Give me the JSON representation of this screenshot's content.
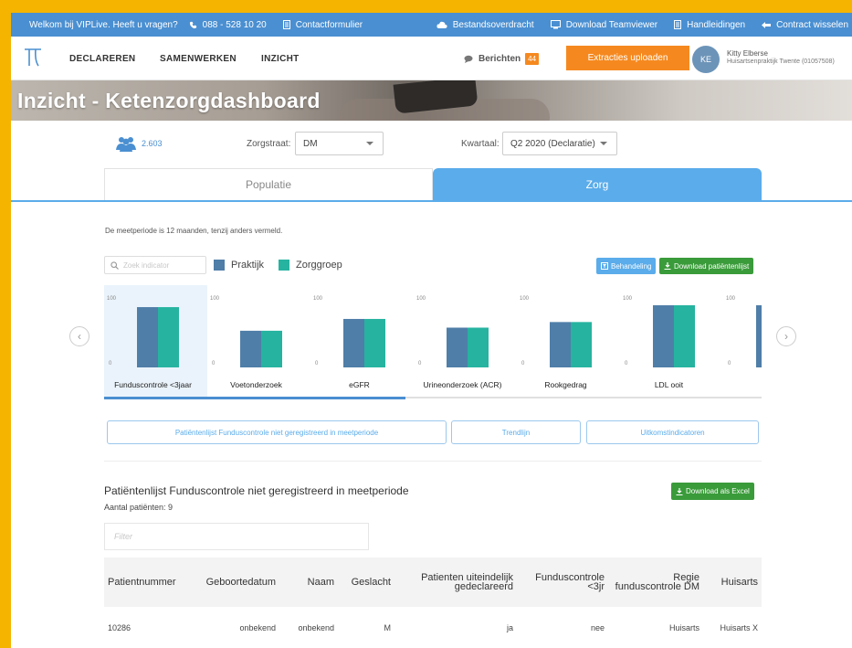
{
  "infobar": {
    "welcome": "Welkom bij VIPLive. Heeft u vragen?",
    "phone": "088 - 528 10 20",
    "contact": "Contactformulier",
    "transfer": "Bestandsoverdracht",
    "teamviewer": "Download Teamviewer",
    "manuals": "Handleidingen",
    "switch_contract": "Contract wisselen"
  },
  "nav": {
    "items": [
      "DECLAREREN",
      "SAMENWERKEN",
      "INZICHT"
    ],
    "berichten_label": "Berichten",
    "berichten_count": "44",
    "upload_button": "Extracties uploaden",
    "user_initials": "KE",
    "user_name": "Kitty Elberse",
    "user_org": "Huisartsenpraktijk Twente (01057508)"
  },
  "hero": {
    "title": "Inzicht - Ketenzorgdashboard"
  },
  "filters": {
    "patient_count": "2.603",
    "zorgstraat_label": "Zorgstraat:",
    "zorgstraat_value": "DM",
    "kwartaal_label": "Kwartaal:",
    "kwartaal_value": "Q2 2020 (Declaratie)"
  },
  "tabs": [
    "Populatie",
    "Zorg"
  ],
  "content": {
    "note": "De meetperiode is 12 maanden, tenzij anders vermeld.",
    "search_placeholder": "Zoek indicator",
    "behandeling_button": "Behandeling",
    "download_patientenlijst": "Download patiëntenlijst"
  },
  "colors": {
    "praktijk": "#4f7ea8",
    "zorggroep": "#26b3a0",
    "accent": "#5aacea",
    "green": "#3a9b3a",
    "orange": "#f5891f"
  },
  "chart_data": {
    "type": "bar",
    "categories": [
      "Funduscontrole <3jaar",
      "Voetonderzoek",
      "eGFR",
      "Urineonderzoek (ACR)",
      "Rookgedrag",
      "LDL ooit",
      ""
    ],
    "series": [
      {
        "name": "Praktijk",
        "values": [
          97,
          59,
          78,
          64,
          73,
          100,
          100
        ]
      },
      {
        "name": "Zorggroep",
        "values": [
          97,
          59,
          78,
          64,
          73,
          100,
          100
        ]
      }
    ],
    "ylim": [
      0,
      100
    ],
    "tick_max_label": "100",
    "tick_min_label": "0",
    "selected_index": 0
  },
  "subtabs": [
    "Patiëntenlijst Funduscontrole niet geregistreerd in meetperiode",
    "Trendlijn",
    "Uitkomstindicatoren"
  ],
  "list": {
    "title": "Patiëntenlijst Funduscontrole niet geregistreerd in meetperiode",
    "count_label": "Aantal patiënten: 9",
    "excel_button": "Download als Excel",
    "filter_placeholder": "Filter",
    "headers": [
      "Patientnummer",
      "Geboortedatum",
      "Naam",
      "Geslacht",
      "Patienten uiteindelijk gedeclareerd",
      "Funduscontrole <3jr",
      "Regie funduscontrole DM",
      "Huisarts"
    ],
    "rows": [
      [
        "10286",
        "onbekend",
        "onbekend",
        "M",
        "ja",
        "nee",
        "Huisarts",
        "Huisarts X"
      ]
    ]
  }
}
